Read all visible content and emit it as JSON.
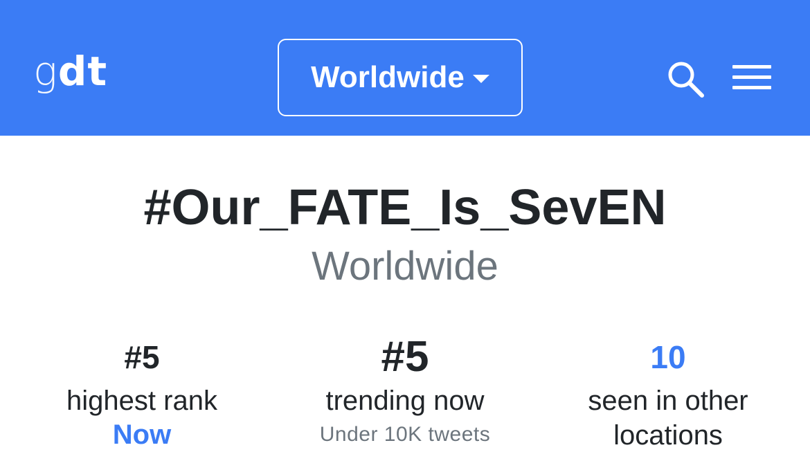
{
  "navbar": {
    "brand_g": "g",
    "brand_dt": "dt",
    "location_selector": "Worldwide",
    "icons": {
      "search": "search-icon",
      "menu": "hamburger-menu-icon",
      "dropdown": "caret-down-icon"
    }
  },
  "trend": {
    "title": "#Our_FATE_Is_SevEN",
    "location": "Worldwide"
  },
  "stats": {
    "highest_rank": {
      "value": "#5",
      "label": "highest rank",
      "when": "Now"
    },
    "trending_now": {
      "value": "#5",
      "label": "trending now",
      "note": "Under 10K tweets"
    },
    "other_locations": {
      "value": "10",
      "label": "seen in other locations"
    }
  },
  "colors": {
    "brand_blue": "#3b7cf5",
    "text_dark": "#212529",
    "text_muted": "#6c757d"
  }
}
